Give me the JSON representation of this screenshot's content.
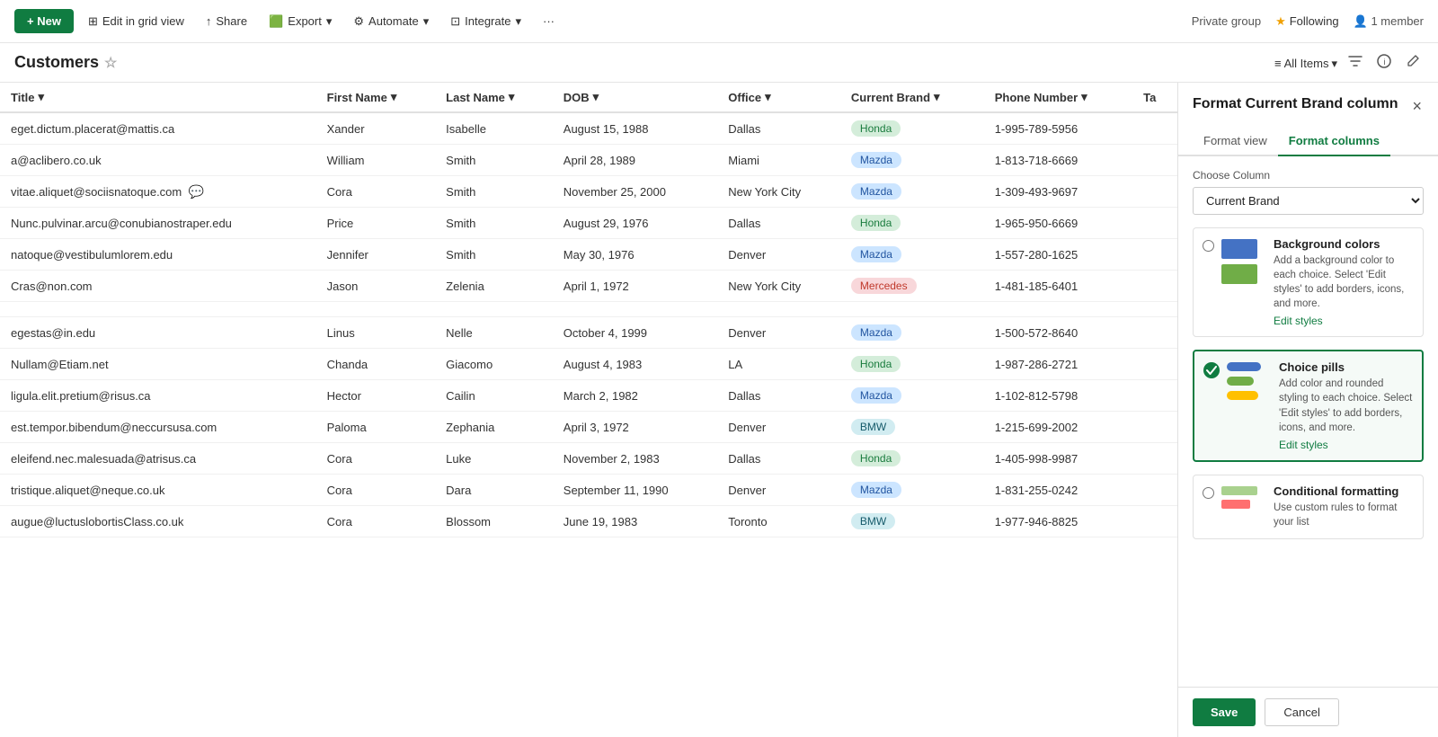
{
  "topbar": {
    "new_label": "+ New",
    "edit_grid_label": "Edit in grid view",
    "share_label": "Share",
    "export_label": "Export",
    "automate_label": "Automate",
    "integrate_label": "Integrate",
    "more_label": "···",
    "private_group_label": "Private group",
    "following_label": "Following",
    "member_label": "1 member",
    "all_items_label": "All Items"
  },
  "page": {
    "title": "Customers",
    "star_label": "☆"
  },
  "table": {
    "columns": [
      "Title",
      "First Name",
      "Last Name",
      "DOB",
      "Office",
      "Current Brand",
      "Phone Number",
      "Ta"
    ],
    "rows": [
      {
        "title": "eget.dictum.placerat@mattis.ca",
        "first_name": "Xander",
        "last_name": "Isabelle",
        "dob": "August 15, 1988",
        "office": "Dallas",
        "brand": "Honda",
        "brand_class": "honda",
        "phone": "1-995-789-5956",
        "ta": "",
        "has_chat": false
      },
      {
        "title": "a@aclibero.co.uk",
        "first_name": "William",
        "last_name": "Smith",
        "dob": "April 28, 1989",
        "office": "Miami",
        "brand": "Mazda",
        "brand_class": "mazda",
        "phone": "1-813-718-6669",
        "ta": "",
        "has_chat": false
      },
      {
        "title": "vitae.aliquet@sociisnatoque.com",
        "first_name": "Cora",
        "last_name": "Smith",
        "dob": "November 25, 2000",
        "office": "New York City",
        "brand": "Mazda",
        "brand_class": "mazda",
        "phone": "1-309-493-9697",
        "ta": "",
        "has_chat": true
      },
      {
        "title": "Nunc.pulvinar.arcu@conubianostraper.edu",
        "first_name": "Price",
        "last_name": "Smith",
        "dob": "August 29, 1976",
        "office": "Dallas",
        "brand": "Honda",
        "brand_class": "honda",
        "phone": "1-965-950-6669",
        "ta": "",
        "has_chat": false
      },
      {
        "title": "natoque@vestibulumlorem.edu",
        "first_name": "Jennifer",
        "last_name": "Smith",
        "dob": "May 30, 1976",
        "office": "Denver",
        "brand": "Mazda",
        "brand_class": "mazda",
        "phone": "1-557-280-1625",
        "ta": "",
        "has_chat": false
      },
      {
        "title": "Cras@non.com",
        "first_name": "Jason",
        "last_name": "Zelenia",
        "dob": "April 1, 1972",
        "office": "New York City",
        "brand": "Mercedes",
        "brand_class": "mercedes",
        "phone": "1-481-185-6401",
        "ta": "",
        "has_chat": false
      },
      {
        "title": "",
        "first_name": "",
        "last_name": "",
        "dob": "",
        "office": "",
        "brand": "",
        "brand_class": "",
        "phone": "",
        "ta": "",
        "has_chat": false
      },
      {
        "title": "egestas@in.edu",
        "first_name": "Linus",
        "last_name": "Nelle",
        "dob": "October 4, 1999",
        "office": "Denver",
        "brand": "Mazda",
        "brand_class": "mazda",
        "phone": "1-500-572-8640",
        "ta": "",
        "has_chat": false
      },
      {
        "title": "Nullam@Etiam.net",
        "first_name": "Chanda",
        "last_name": "Giacomo",
        "dob": "August 4, 1983",
        "office": "LA",
        "brand": "Honda",
        "brand_class": "honda",
        "phone": "1-987-286-2721",
        "ta": "",
        "has_chat": false
      },
      {
        "title": "ligula.elit.pretium@risus.ca",
        "first_name": "Hector",
        "last_name": "Cailin",
        "dob": "March 2, 1982",
        "office": "Dallas",
        "brand": "Mazda",
        "brand_class": "mazda",
        "phone": "1-102-812-5798",
        "ta": "",
        "has_chat": false
      },
      {
        "title": "est.tempor.bibendum@neccursusa.com",
        "first_name": "Paloma",
        "last_name": "Zephania",
        "dob": "April 3, 1972",
        "office": "Denver",
        "brand": "BMW",
        "brand_class": "bmw",
        "phone": "1-215-699-2002",
        "ta": "",
        "has_chat": false
      },
      {
        "title": "eleifend.nec.malesuada@atrisus.ca",
        "first_name": "Cora",
        "last_name": "Luke",
        "dob": "November 2, 1983",
        "office": "Dallas",
        "brand": "Honda",
        "brand_class": "honda",
        "phone": "1-405-998-9987",
        "ta": "",
        "has_chat": false
      },
      {
        "title": "tristique.aliquet@neque.co.uk",
        "first_name": "Cora",
        "last_name": "Dara",
        "dob": "September 11, 1990",
        "office": "Denver",
        "brand": "Mazda",
        "brand_class": "mazda",
        "phone": "1-831-255-0242",
        "ta": "",
        "has_chat": false
      },
      {
        "title": "augue@luctuslobortisClass.co.uk",
        "first_name": "Cora",
        "last_name": "Blossom",
        "dob": "June 19, 1983",
        "office": "Toronto",
        "brand": "BMW",
        "brand_class": "bmw",
        "phone": "1-977-946-8825",
        "ta": "",
        "has_chat": false
      }
    ]
  },
  "panel": {
    "title": "Format Current Brand column",
    "close_label": "×",
    "tabs": [
      {
        "label": "Format view",
        "active": false
      },
      {
        "label": "Format columns",
        "active": true
      }
    ],
    "choose_column_label": "Choose Column",
    "column_value": "Current Brand",
    "options": [
      {
        "id": "background-colors",
        "name": "Background colors",
        "desc": "Add a background color to each choice. Select 'Edit styles' to add borders, icons, and more.",
        "edit_styles_label": "Edit styles",
        "selected": false
      },
      {
        "id": "choice-pills",
        "name": "Choice pills",
        "desc": "Add color and rounded styling to each choice. Select 'Edit styles' to add borders, icons, and more.",
        "edit_styles_label": "Edit styles",
        "selected": true
      },
      {
        "id": "conditional-formatting",
        "name": "Conditional formatting",
        "desc": "Use custom rules to format your list",
        "edit_styles_label": "",
        "selected": false
      }
    ],
    "save_label": "Save",
    "cancel_label": "Cancel"
  }
}
